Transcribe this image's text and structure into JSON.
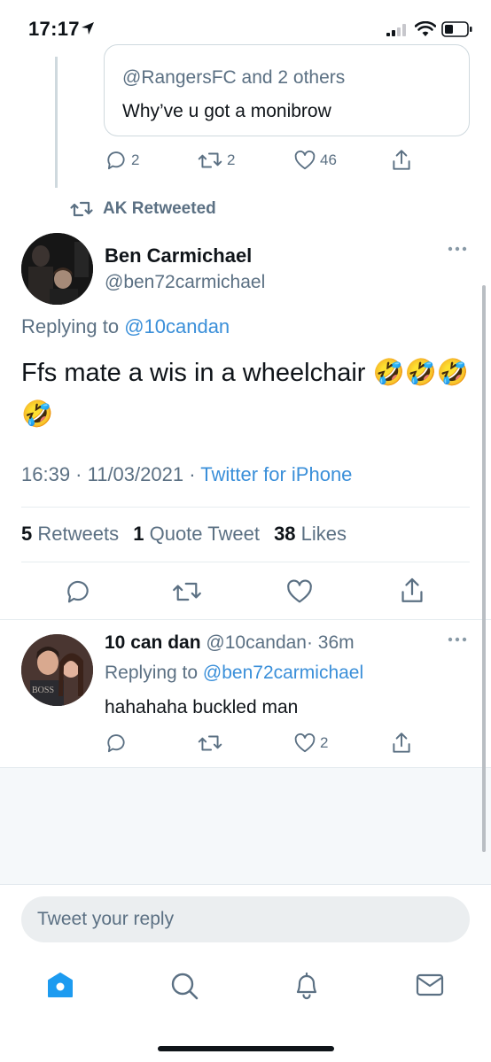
{
  "status_bar": {
    "time": "17:17"
  },
  "quoted_tweet": {
    "replying_to": "@RangersFC and 2 others",
    "text": "Why’ve u got a monibrow",
    "replies": "2",
    "retweets": "2",
    "likes": "46"
  },
  "retweeted_by": "AK Retweeted",
  "main_tweet": {
    "name": "Ben Carmichael",
    "handle": "@ben72carmichael",
    "replying_prefix": "Replying to ",
    "replying_handle": "@10candan",
    "text": "Ffs mate a wis in a wheelchair 🤣🤣🤣🤣",
    "time": "16:39 · 11/03/2021 · ",
    "source": "Twitter for iPhone",
    "retweets_count": "5",
    "retweets_label": "Retweets",
    "quotes_count": "1",
    "quotes_label": "Quote Tweet",
    "likes_count": "38",
    "likes_label": "Likes"
  },
  "reply_tweet": {
    "name": "10 can dan",
    "handle": "@10candan",
    "time": "· 36m",
    "replying_prefix": "Replying to ",
    "replying_handle": "@ben72carmichael",
    "text": "hahahaha buckled man",
    "likes": "2"
  },
  "composer": {
    "placeholder": "Tweet your reply"
  },
  "tab_bar": {
    "items": [
      "home-icon",
      "search-icon",
      "notifications-icon",
      "messages-icon"
    ],
    "active": "home-icon"
  },
  "colors": {
    "accent": "#1d9bf0",
    "link": "#3a8fd9",
    "muted": "#5b7083"
  }
}
